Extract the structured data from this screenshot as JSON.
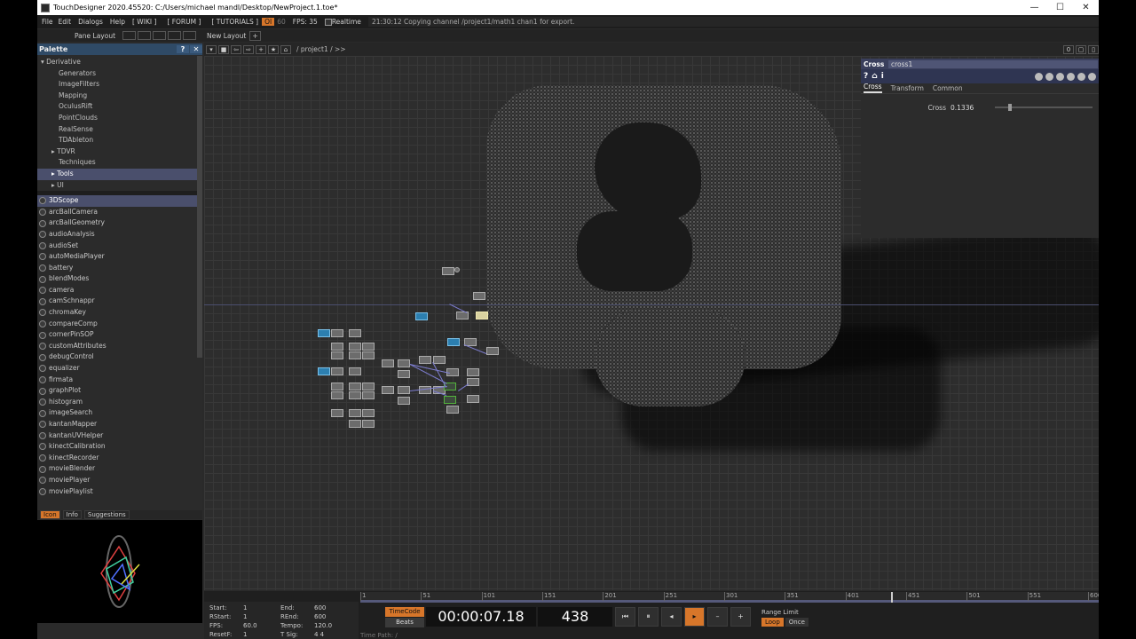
{
  "window": {
    "title": "TouchDesigner 2020.45520: C:/Users/michael mandl/Desktop/NewProject.1.toe*",
    "minimize": "—",
    "maximize": "☐",
    "close": "✕"
  },
  "menu": {
    "items": [
      "File",
      "Edit",
      "Dialogs",
      "Help"
    ],
    "links": [
      "[ WIKI ]",
      "[ FORUM ]",
      "[ TUTORIALS ]"
    ],
    "oi": "OI",
    "sixty": "60",
    "fps": "FPS: 35",
    "realtime": "Realtime",
    "status": "21:30:12 Copying channel /project1/math1 chan1 for export."
  },
  "panebar": {
    "pane_layout": "Pane Layout",
    "new_layout": "New Layout",
    "plus": "+"
  },
  "palette": {
    "title": "Palette",
    "help": "?",
    "close": "✕",
    "tree": [
      {
        "label": "▾ Derivative",
        "level": "root"
      },
      {
        "label": "Generators",
        "level": "child"
      },
      {
        "label": "ImageFilters",
        "level": "child"
      },
      {
        "label": "Mapping",
        "level": "child"
      },
      {
        "label": "OculusRift",
        "level": "child"
      },
      {
        "label": "PointClouds",
        "level": "child"
      },
      {
        "label": "RealSense",
        "level": "child"
      },
      {
        "label": "TDAbleton",
        "level": "child"
      },
      {
        "label": "▸ TDVR",
        "level": "sub"
      },
      {
        "label": "Techniques",
        "level": "child"
      },
      {
        "label": "▸ Tools",
        "level": "sub",
        "selected": true
      },
      {
        "label": "▸ UI",
        "level": "sub"
      }
    ],
    "items": [
      "3DScope",
      "arcBallCamera",
      "arcBallGeometry",
      "audioAnalysis",
      "audioSet",
      "autoMediaPlayer",
      "battery",
      "blendModes",
      "camera",
      "camSchnappr",
      "chromaKey",
      "compareComp",
      "cornerPinSOP",
      "customAttributes",
      "debugControl",
      "equalizer",
      "firmata",
      "graphPlot",
      "histogram",
      "imageSearch",
      "kantanMapper",
      "kantanUVHelper",
      "kinectCalibration",
      "kinectRecorder",
      "movieBlender",
      "moviePlayer",
      "moviePlaylist"
    ],
    "tabs": [
      "Icon",
      "Info",
      "Suggestions"
    ]
  },
  "network": {
    "path": "/ project1 / >>",
    "zoom": "0"
  },
  "param": {
    "type": "Cross",
    "name": "cross1",
    "tabs": [
      "Cross",
      "Transform",
      "Common"
    ],
    "cross_label": "Cross",
    "cross_value": "0.1336",
    "cross_fraction": 0.1336,
    "help": "?",
    "info": "i"
  },
  "timeline": {
    "info": [
      [
        "Start:",
        "1",
        "End:",
        "600"
      ],
      [
        "RStart:",
        "1",
        "REnd:",
        "600"
      ],
      [
        "FPS:",
        "60.0",
        "Tempo:",
        "120.0"
      ],
      [
        "ResetF:",
        "1",
        "T Sig:",
        "4     4"
      ]
    ],
    "ticks": [
      "1",
      "51",
      "101",
      "151",
      "201",
      "251",
      "301",
      "351",
      "401",
      "451",
      "501",
      "551",
      "600"
    ],
    "timecode_btn": "TimeCode",
    "beats_btn": "Beats",
    "timecode": "00:00:07.18",
    "frame": "438",
    "buttons": [
      "⏮",
      "⏸",
      "◂",
      "▸",
      "–",
      "+"
    ],
    "range_limit": "Range Limit",
    "loop": "Loop",
    "once": "Once",
    "time_path": "Time Path: /"
  }
}
